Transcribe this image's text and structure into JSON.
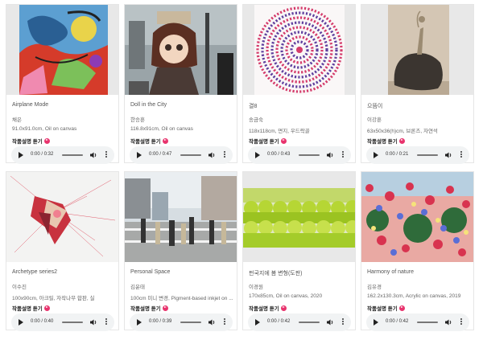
{
  "listen_label": "작품설명 듣기",
  "artworks": [
    {
      "title": "Airplane Mode",
      "artist": "채은",
      "spec": "91.0x91.0cm, Oil on canvas",
      "time": "0:00 / 0:32"
    },
    {
      "title": "Doll in the City",
      "artist": "한승훈",
      "spec": "116.8x91cm, Oil on canvas",
      "time": "0:00 / 0:47"
    },
    {
      "title": "결8",
      "artist": "송금숙",
      "spec": "118x118cm, 면지, 우드락골",
      "time": "0:00 / 0:43"
    },
    {
      "title": "으뜸이",
      "artist": "이강훈",
      "spec": "63x50x36(h)cm, 브론즈, 자연석",
      "time": "0:00 / 0:21"
    },
    {
      "title": "Archetype series2",
      "artist": "이수진",
      "spec": "100x90cm, 아크릴, 자작나무 합판, 실",
      "time": "0:00 / 0:40"
    },
    {
      "title": "Personal Space",
      "artist": "김윤태",
      "spec": "100cm 미니 변경, Pigment-based inkjet on ...",
      "time": "0:00 / 0:39"
    },
    {
      "title": "펀국지에 봄 변형(도판)",
      "artist": "이경원",
      "spec": "170x85cm, Oil on canvas, 2020",
      "time": "0:00 / 0:42"
    },
    {
      "title": "Harmony of nature",
      "artist": "김유경",
      "spec": "162.2x130.3cm, Acrylic on canvas, 2019",
      "time": "0:00 / 0:42"
    }
  ]
}
